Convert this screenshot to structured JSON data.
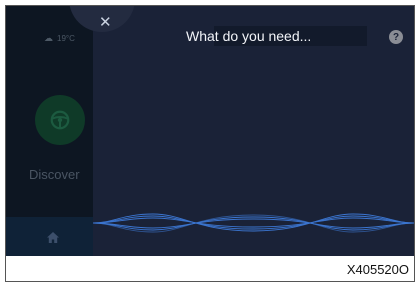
{
  "status": {
    "temperature": "19°C",
    "weather_icon": "cloud-icon"
  },
  "home": {
    "app_label": "Discover",
    "app_icon": "steering-wheel-icon",
    "home_icon": "home-icon"
  },
  "voice": {
    "prompt": "What do you need...",
    "close_icon": "close-icon",
    "help_icon": "help-icon",
    "help_glyph": "?",
    "waveform_icon": "voice-waveform-icon"
  },
  "figure": {
    "caption": "X405520O"
  },
  "colors": {
    "background": "#0b1120",
    "overlay": "#1a2237",
    "accent": "#3f7ee0",
    "app_circle": "#0f3a28"
  }
}
